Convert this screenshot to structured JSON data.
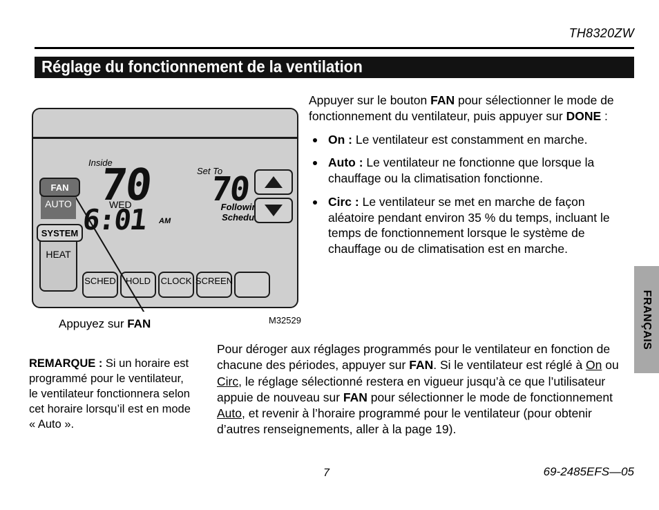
{
  "page": {
    "model_code": "TH8320ZW",
    "section_title": "Réglage du fonctionnement de la ventilation",
    "page_number": "7",
    "doc_code": "69-2485EFS—05",
    "side_tab_label": "FRANÇAIS"
  },
  "figure": {
    "caption_prefix": "Appuyez sur ",
    "caption_bold": "FAN",
    "figure_id": "M32529",
    "thermostat": {
      "fan_button_label": "FAN",
      "fan_mode_value": "AUTO",
      "system_button_label": "SYSTEM",
      "system_mode_value": "HEAT",
      "inside_label": "Inside",
      "inside_temp": "70",
      "set_to_label": "Set To",
      "set_to_temp": "70",
      "day_label": "WED",
      "time_value": "6:01",
      "time_meridiem": "AM",
      "schedule_status_line1": "Following",
      "schedule_status_line2": "Schedule",
      "up_arrow": "up-arrow",
      "down_arrow": "down-arrow",
      "soft_buttons": [
        "SCHED",
        "HOLD",
        "CLOCK",
        "SCREEN",
        ""
      ]
    }
  },
  "note": {
    "label": "REMARQUE :",
    "text": " Si un horaire est programmé pour le ventilateur, le ventilateur fonctionnera selon cet horaire lorsqu’il est en mode « Auto »."
  },
  "right_column": {
    "intro_part1": "Appuyer sur le bouton ",
    "intro_bold1": "FAN",
    "intro_part2": " pour sélectionner le mode de fonctionnement du ventilateur, puis appuyer sur ",
    "intro_bold2": "DONE",
    "intro_part3": " :",
    "bullets": [
      {
        "term": "On :",
        "text": " Le ventilateur est constamment en marche."
      },
      {
        "term": "Auto :",
        "text": " Le ventilateur ne fonctionne que lorsque la chauffage ou la climatisation fonctionne."
      },
      {
        "term": "Circ :",
        "text": " Le ventilateur se met en marche de façon aléatoire pendant environ 35 % du temps, incluant le temps de fonctionnement lorsque le système de chauffage ou de climatisation est en marche."
      }
    ]
  },
  "bottom_paragraph": {
    "seg1": "Pour déroger aux réglages programmés pour le ventilateur en fonction de chacune des périodes, appuyer sur ",
    "bold1": "FAN",
    "seg2": ". Si le ventilateur est réglé à ",
    "underline1": "On",
    "seg3": " ou ",
    "underline2": "Circ",
    "seg4": ", le réglage sélectionné restera en vigueur jusqu’à ce que l’utilisateur appuie de nouveau sur ",
    "bold2": "FAN",
    "seg5": " pour sélectionner le mode de fonctionnement ",
    "underline3": "Auto",
    "seg6": ", et revenir à l’horaire programmé pour le ventilateur (pour obtenir d’autres renseignements, aller à la page 19)."
  }
}
